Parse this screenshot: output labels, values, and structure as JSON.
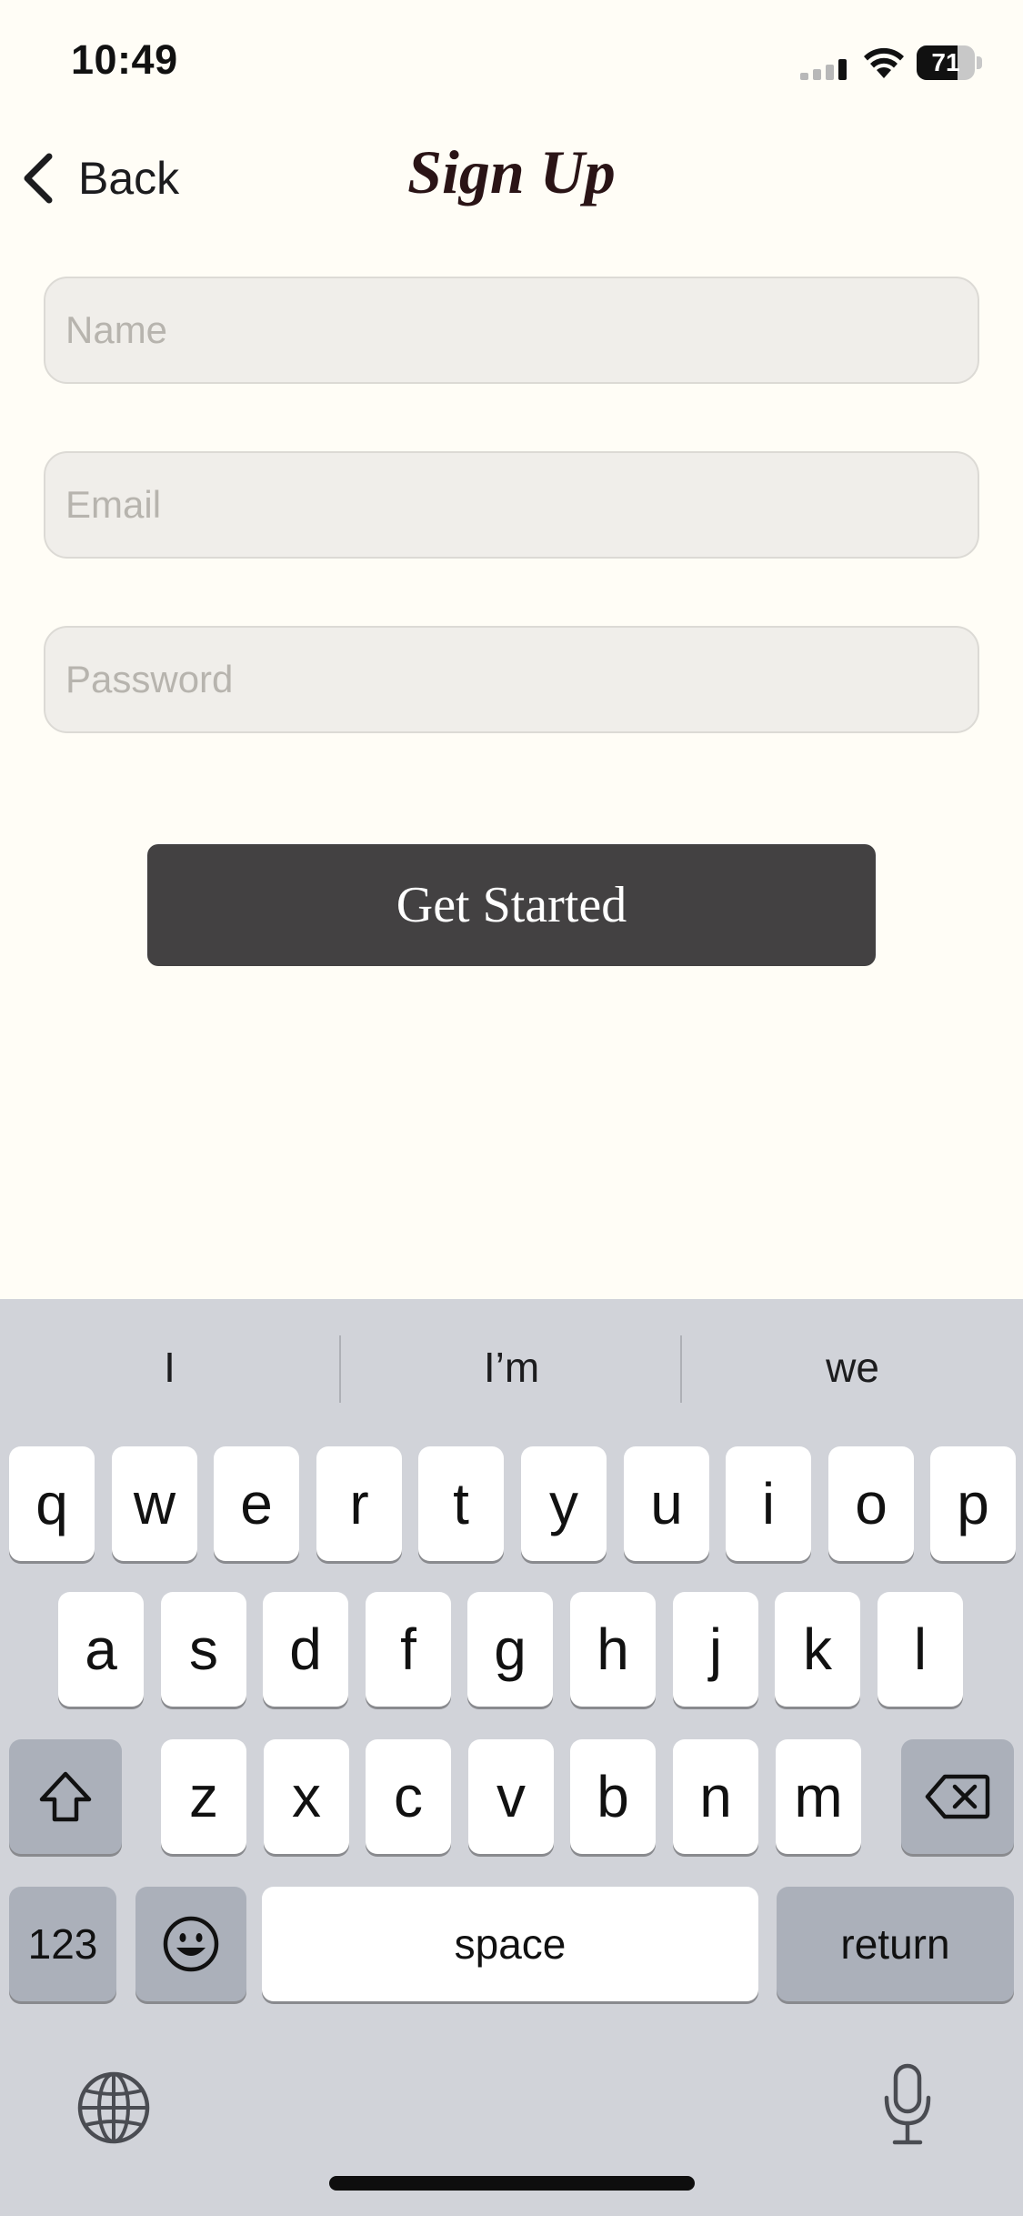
{
  "status_bar": {
    "time": "10:49",
    "battery_level": "71",
    "battery_fraction": 0.71
  },
  "nav": {
    "back_label": "Back",
    "title": "Sign Up"
  },
  "form": {
    "name_placeholder": "Name",
    "email_placeholder": "Email",
    "password_placeholder": "Password",
    "submit_label": "Get Started"
  },
  "colors": {
    "background": "#fffdf6",
    "field_background": "#f0eeea",
    "button_background": "#434142",
    "title_color": "#2a1416",
    "keyboard_background": "#d1d3d9"
  },
  "keyboard": {
    "suggestions": [
      "I",
      "I’m",
      "we"
    ],
    "row1": [
      "q",
      "w",
      "e",
      "r",
      "t",
      "y",
      "u",
      "i",
      "o",
      "p"
    ],
    "row2": [
      "a",
      "s",
      "d",
      "f",
      "g",
      "h",
      "j",
      "k",
      "l"
    ],
    "row3": [
      "z",
      "x",
      "c",
      "v",
      "b",
      "n",
      "m"
    ],
    "numbers_label": "123",
    "space_label": "space",
    "return_label": "return",
    "icons": [
      "shift-icon",
      "delete-icon",
      "emoji-icon",
      "globe-icon",
      "microphone-icon"
    ]
  }
}
